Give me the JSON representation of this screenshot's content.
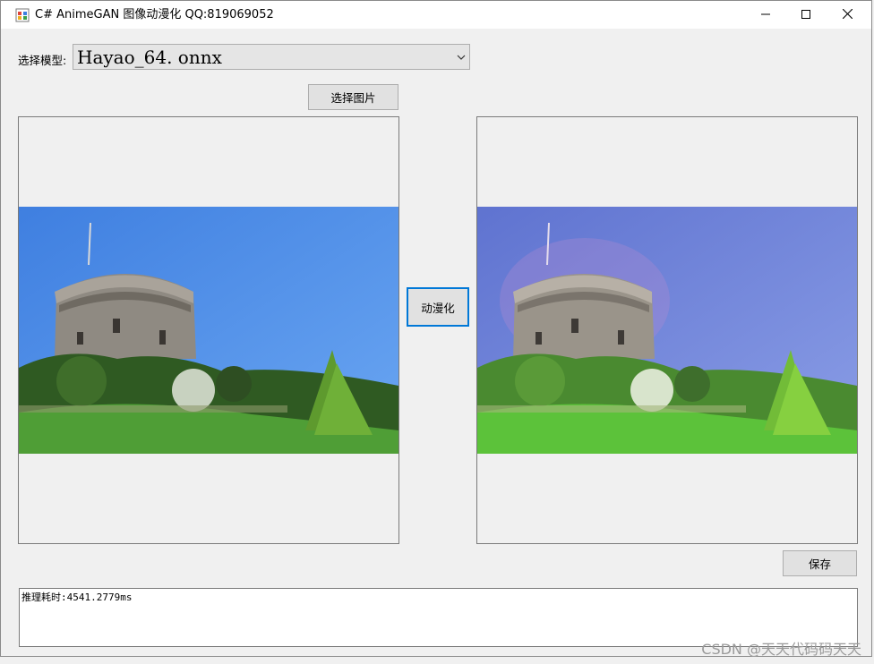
{
  "window": {
    "title": "C# AnimeGAN 图像动漫化 QQ:819069052",
    "icon": "app-form-icon",
    "controls": [
      "minimize-icon",
      "maximize-icon",
      "close-icon"
    ]
  },
  "model": {
    "label": "选择模型:",
    "selected": "Hayao_64. onnx"
  },
  "buttons": {
    "select_image": "选择图片",
    "animate": "动漫化",
    "save": "保存"
  },
  "images": {
    "input": "castle-photo",
    "output": "castle-anime"
  },
  "log": {
    "text": "推理耗时:4541.2779ms"
  },
  "watermark": "CSDN @天天代码码天天",
  "colors": {
    "focus": "#0078d7",
    "sky": "#4a88e8",
    "anime_sky": "#6e7fd6"
  }
}
